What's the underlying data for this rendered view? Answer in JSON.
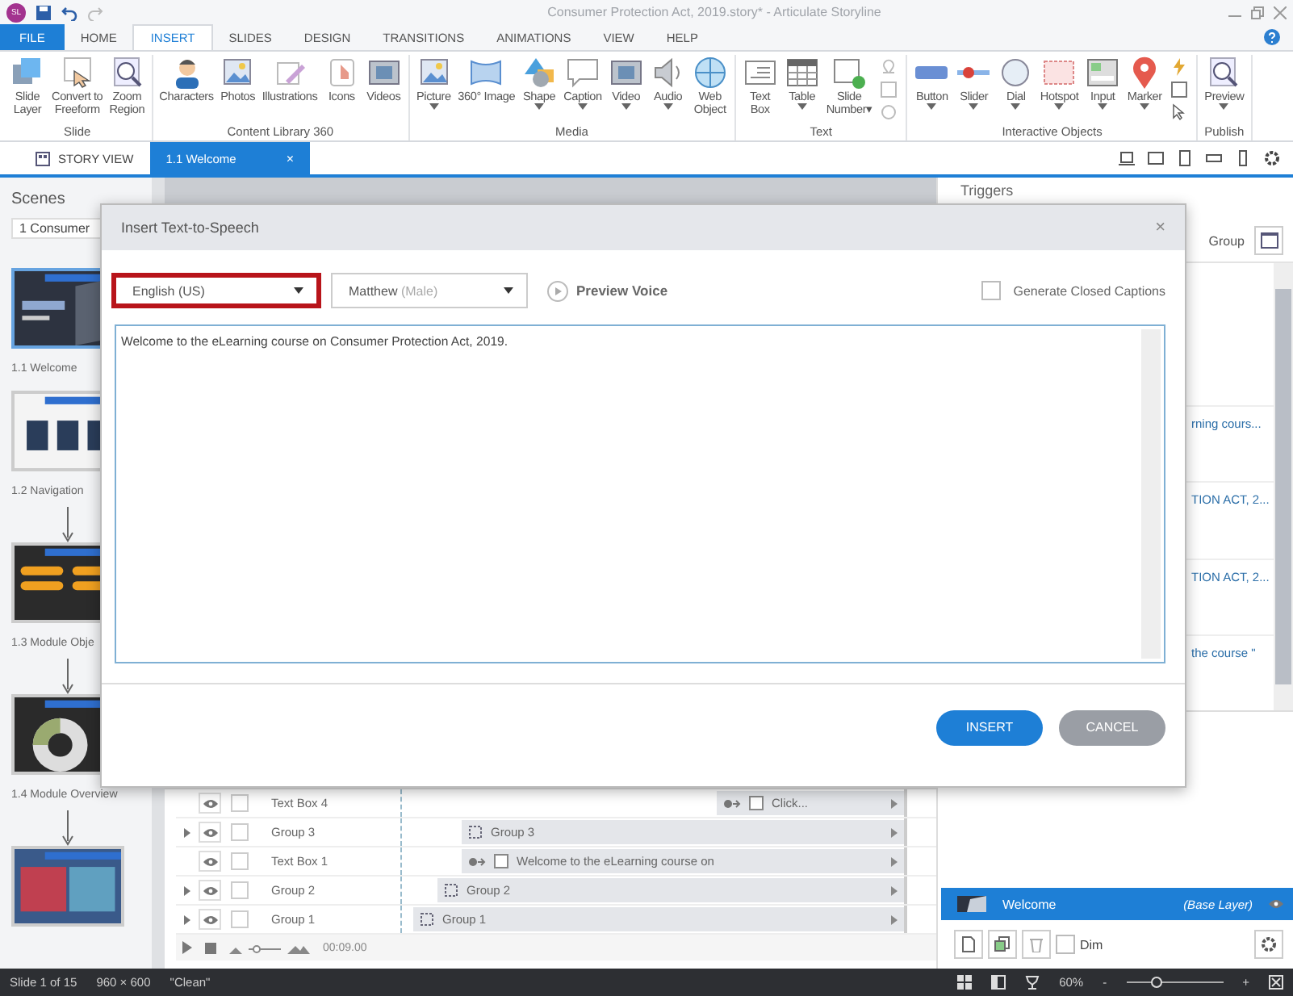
{
  "app": {
    "logo": "SL",
    "title": "Consumer Protection Act, 2019.story* - Articulate Storyline"
  },
  "ribbon_tabs": [
    {
      "label": "FILE",
      "kind": "file",
      "selected": false
    },
    {
      "label": "HOME",
      "kind": "tab",
      "selected": false
    },
    {
      "label": "INSERT",
      "kind": "tab",
      "selected": true
    },
    {
      "label": "SLIDES",
      "kind": "tab",
      "selected": false
    },
    {
      "label": "DESIGN",
      "kind": "tab",
      "selected": false
    },
    {
      "label": "TRANSITIONS",
      "kind": "tab",
      "selected": false
    },
    {
      "label": "ANIMATIONS",
      "kind": "tab",
      "selected": false
    },
    {
      "label": "VIEW",
      "kind": "tab",
      "selected": false
    },
    {
      "label": "HELP",
      "kind": "tab",
      "selected": false
    }
  ],
  "ribbon_groups": [
    {
      "title": "Slide",
      "kind": "plain",
      "buttons": [
        {
          "kind": "layer",
          "label": "Slide\nLayer",
          "dropdown": false
        },
        {
          "kind": "freeform",
          "label": "Convert to\nFreeform",
          "dropdown": false
        },
        {
          "kind": "zoom",
          "label": "Zoom\nRegion",
          "dropdown": false
        }
      ]
    },
    {
      "title": "Content Library 360",
      "kind": "plain",
      "buttons": [
        {
          "kind": "characters",
          "label": "Characters",
          "dropdown": false
        },
        {
          "kind": "photos",
          "label": "Photos",
          "dropdown": false
        },
        {
          "kind": "illustrations",
          "label": "Illustrations",
          "dropdown": false
        },
        {
          "kind": "icons",
          "label": "Icons",
          "dropdown": false
        },
        {
          "kind": "videos",
          "label": "Videos",
          "dropdown": false
        }
      ]
    },
    {
      "title": "Media",
      "kind": "plain",
      "buttons": [
        {
          "kind": "picture",
          "label": "Picture",
          "dropdown": true
        },
        {
          "kind": "image360",
          "label": "360° Image",
          "dropdown": false
        },
        {
          "kind": "shape",
          "label": "Shape",
          "dropdown": true
        },
        {
          "kind": "caption",
          "label": "Caption",
          "dropdown": true
        },
        {
          "kind": "videos",
          "label": "Video",
          "dropdown": true
        },
        {
          "kind": "audio",
          "label": "Audio",
          "dropdown": true
        },
        {
          "kind": "web",
          "label": "Web\nObject",
          "dropdown": false
        }
      ]
    },
    {
      "title": "Text",
      "kind": "text",
      "buttons": [
        {
          "kind": "textbox",
          "label": "Text\nBox",
          "dropdown": false
        },
        {
          "kind": "table",
          "label": "Table",
          "dropdown": true
        },
        {
          "kind": "slidenumber",
          "label": "Slide\nNumber▾",
          "dropdown": false
        }
      ]
    },
    {
      "title": "Interactive Objects",
      "kind": "interactive",
      "buttons": [
        {
          "kind": "button",
          "label": "Button",
          "dropdown": true
        },
        {
          "kind": "slider",
          "label": "Slider",
          "dropdown": true
        },
        {
          "kind": "dial",
          "label": "Dial",
          "dropdown": true
        },
        {
          "kind": "hotspot",
          "label": "Hotspot",
          "dropdown": true
        },
        {
          "kind": "input",
          "label": "Input",
          "dropdown": true
        },
        {
          "kind": "marker",
          "label": "Marker",
          "dropdown": true
        }
      ]
    },
    {
      "title": "Publish",
      "kind": "plain",
      "buttons": [
        {
          "kind": "preview",
          "label": "Preview",
          "dropdown": true
        }
      ]
    }
  ],
  "doc_tabs": [
    {
      "label": "STORY VIEW",
      "kind": "story",
      "selected": false
    },
    {
      "label": "1.1 Welcome",
      "kind": "slide",
      "selected": true,
      "close": "×"
    }
  ],
  "scenes": {
    "title": "Scenes",
    "dropdown": "1 Consumer",
    "slides": [
      {
        "label": "1.1 Welcome",
        "selected": true,
        "arrow_after": false
      },
      {
        "label": "1.2 Navigation",
        "selected": false,
        "arrow_after": true
      },
      {
        "label": "1.3 Module Obje",
        "selected": false,
        "arrow_after": true
      },
      {
        "label": "1.4 Module Overview",
        "selected": false,
        "arrow_after": true
      },
      {
        "selected": false,
        "arrow_after": false
      }
    ]
  },
  "timeline": {
    "rows": [
      {
        "name": "Text Box 4",
        "locked": false,
        "expandable": false,
        "kind": "text",
        "bar": "Click..."
      },
      {
        "name": "Group 3",
        "locked": false,
        "expandable": true,
        "kind": "group",
        "bar": "Group 3"
      },
      {
        "name": "Text Box 1",
        "locked": false,
        "expandable": false,
        "kind": "text",
        "bar": "Welcome to the eLearning course on"
      },
      {
        "name": "Group 2",
        "locked": false,
        "expandable": true,
        "kind": "group",
        "bar": "Group 2"
      },
      {
        "name": "Group 1",
        "locked": false,
        "expandable": true,
        "kind": "group",
        "bar": "Group 1"
      }
    ],
    "time": "00:09.00"
  },
  "triggers": {
    "title": "Triggers",
    "group_label": "Group",
    "entries": [
      "rning cours...",
      "TION ACT, 2...",
      "TION ACT, 2...",
      "the course \""
    ]
  },
  "layers": {
    "rows": [
      {
        "name": "Welcome",
        "note": "(Base Layer)",
        "selected": true
      }
    ],
    "dim_label": "Dim",
    "dim_checked": false
  },
  "status": {
    "slide": "Slide 1 of 15",
    "size": "960 × 600",
    "theme": "\"Clean\"",
    "zoom": "60%",
    "zoom_minus": "-",
    "zoom_plus": "+",
    "zoom_slider": {
      "level": 0.3
    }
  },
  "dialog": {
    "title": "Insert Text-to-Speech",
    "close": "×",
    "language": {
      "value": "English (US)",
      "highlighted": true
    },
    "voice": {
      "name": "Matthew",
      "gender": "(Male)"
    },
    "preview": "Preview Voice",
    "captions": {
      "label": "Generate Closed Captions",
      "checked": false
    },
    "text": "Welcome to the eLearning course on Consumer Protection Act, 2019.",
    "buttons": [
      {
        "label": "INSERT",
        "kind": "primary"
      },
      {
        "label": "CANCEL",
        "kind": "secondary"
      }
    ]
  }
}
